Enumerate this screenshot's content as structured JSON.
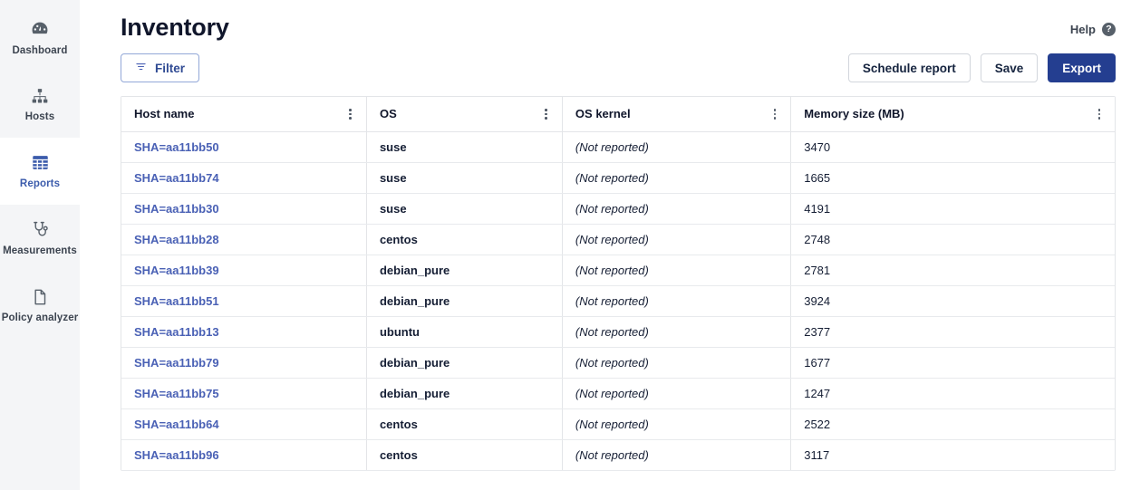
{
  "sidebar": {
    "items": [
      {
        "label": "Dashboard",
        "icon": "gauge-icon",
        "active": false
      },
      {
        "label": "Hosts",
        "icon": "sitemap-icon",
        "active": false
      },
      {
        "label": "Reports",
        "icon": "table-grid-icon",
        "active": true
      },
      {
        "label": "Measurements",
        "icon": "stethoscope-icon",
        "active": false
      },
      {
        "label": "Policy analyzer",
        "icon": "document-icon",
        "active": false
      }
    ]
  },
  "header": {
    "title": "Inventory",
    "help_label": "Help",
    "help_icon": "question-circle-icon"
  },
  "toolbar": {
    "filter_label": "Filter",
    "filter_icon": "filter-icon",
    "schedule_report_label": "Schedule report",
    "save_label": "Save",
    "export_label": "Export"
  },
  "table": {
    "columns": [
      {
        "label": "Host name",
        "align": "left"
      },
      {
        "label": "OS",
        "align": "left"
      },
      {
        "label": "OS kernel",
        "align": "left"
      },
      {
        "label": "Memory size (MB)",
        "align": "left"
      }
    ],
    "column_menu_icon": "kebab-menu-icon",
    "rows": [
      {
        "host": "SHA=aa11bb50",
        "os": "suse",
        "kernel": "(Not reported)",
        "memory": "3470"
      },
      {
        "host": "SHA=aa11bb74",
        "os": "suse",
        "kernel": "(Not reported)",
        "memory": "1665"
      },
      {
        "host": "SHA=aa11bb30",
        "os": "suse",
        "kernel": "(Not reported)",
        "memory": "4191"
      },
      {
        "host": "SHA=aa11bb28",
        "os": "centos",
        "kernel": "(Not reported)",
        "memory": "2748"
      },
      {
        "host": "SHA=aa11bb39",
        "os": "debian_pure",
        "kernel": "(Not reported)",
        "memory": "2781"
      },
      {
        "host": "SHA=aa11bb51",
        "os": "debian_pure",
        "kernel": "(Not reported)",
        "memory": "3924"
      },
      {
        "host": "SHA=aa11bb13",
        "os": "ubuntu",
        "kernel": "(Not reported)",
        "memory": "2377"
      },
      {
        "host": "SHA=aa11bb79",
        "os": "debian_pure",
        "kernel": "(Not reported)",
        "memory": "1677"
      },
      {
        "host": "SHA=aa11bb75",
        "os": "debian_pure",
        "kernel": "(Not reported)",
        "memory": "1247"
      },
      {
        "host": "SHA=aa11bb64",
        "os": "centos",
        "kernel": "(Not reported)",
        "memory": "2522"
      },
      {
        "host": "SHA=aa11bb96",
        "os": "centos",
        "kernel": "(Not reported)",
        "memory": "3117"
      }
    ]
  },
  "colors": {
    "sidebar_bg": "#f4f5f7",
    "accent_blue": "#243e90",
    "link_blue": "#4a61b5",
    "title_dark": "#10162b",
    "muted_gray": "#9ba1ab"
  }
}
